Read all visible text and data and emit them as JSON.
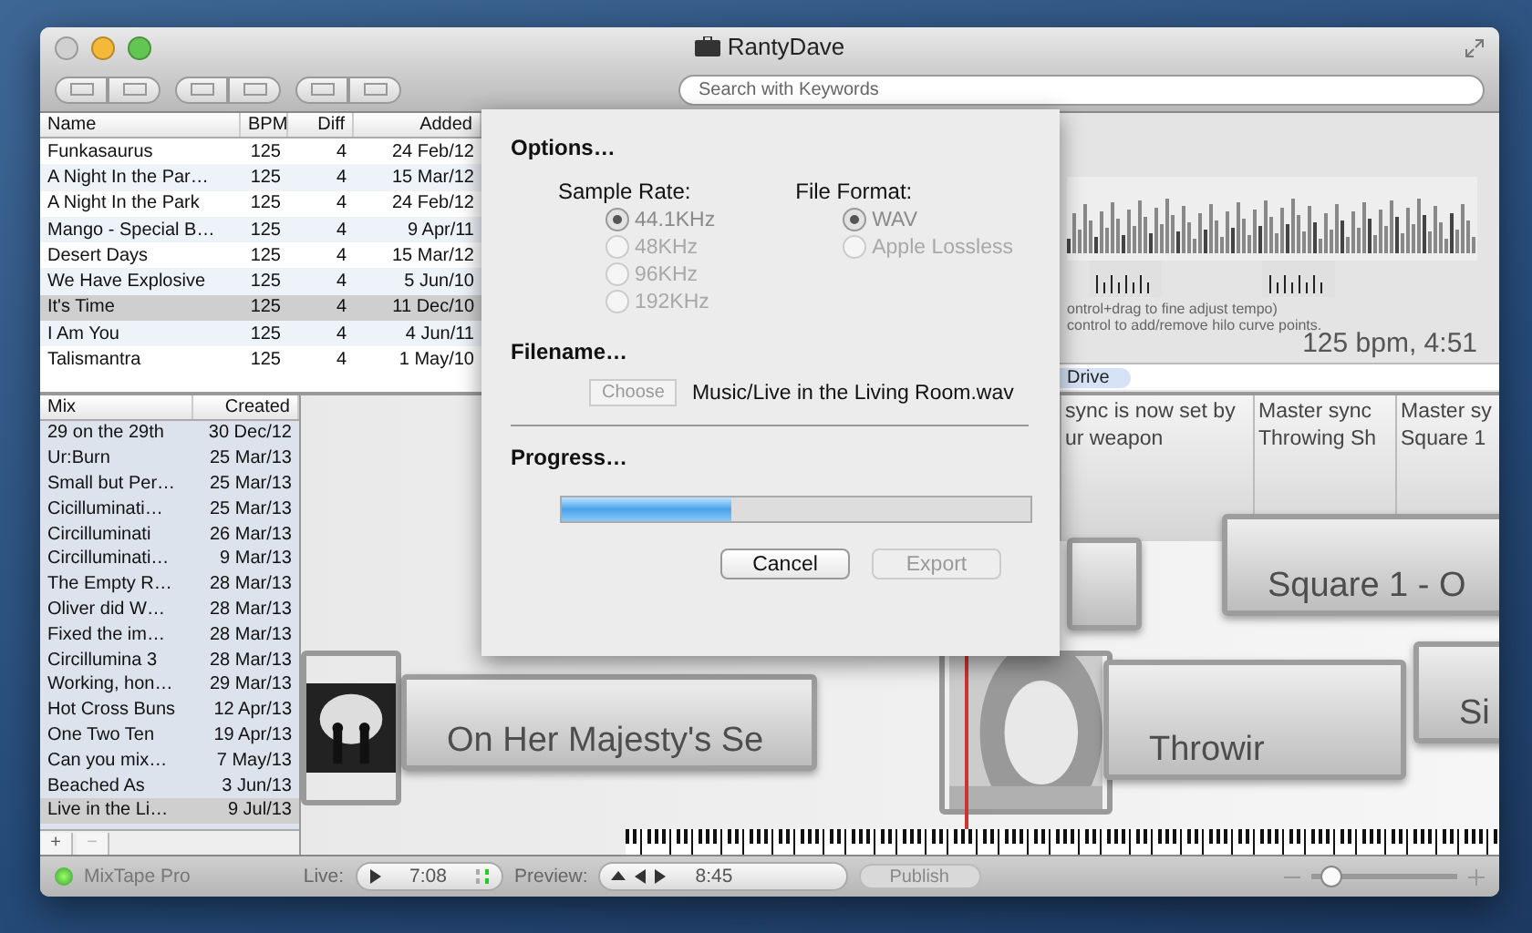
{
  "window": {
    "title": "RantyDave"
  },
  "search": {
    "placeholder": "Search with Keywords"
  },
  "tracks": {
    "columns": [
      "Name",
      "BPM",
      "Diff",
      "Added"
    ],
    "rows": [
      {
        "cells": [
          "Funkasaurus",
          "125",
          "4",
          "24 Feb/12"
        ],
        "selected": false
      },
      {
        "cells": [
          "A Night In the Par…",
          "125",
          "4",
          "15 Mar/12"
        ],
        "selected": false
      },
      {
        "cells": [
          "A Night In the Park",
          "125",
          "4",
          "24 Feb/12"
        ],
        "selected": false
      },
      {
        "cells": [
          "Mango - Special B…",
          "125",
          "4",
          "9 Apr/11"
        ],
        "selected": false
      },
      {
        "cells": [
          "Desert Days",
          "125",
          "4",
          "15 Mar/12"
        ],
        "selected": false
      },
      {
        "cells": [
          "We Have Explosive",
          "125",
          "4",
          "5 Jun/10"
        ],
        "selected": false
      },
      {
        "cells": [
          "It's Time",
          "125",
          "4",
          "11 Dec/10"
        ],
        "selected": true
      },
      {
        "cells": [
          "I Am You",
          "125",
          "4",
          "4 Jun/11"
        ],
        "selected": false
      },
      {
        "cells": [
          "Talismantra",
          "125",
          "4",
          "1 May/10"
        ],
        "selected": false
      }
    ]
  },
  "mixes": {
    "columns": [
      "Mix",
      "Created"
    ],
    "rows": [
      {
        "cells": [
          "29 on the 29th",
          "30 Dec/12"
        ],
        "selected": false
      },
      {
        "cells": [
          "Ur:Burn",
          "25 Mar/13"
        ],
        "selected": false
      },
      {
        "cells": [
          "Small but Per…",
          "25 Mar/13"
        ],
        "selected": false
      },
      {
        "cells": [
          "Cicilluminati…",
          "25 Mar/13"
        ],
        "selected": false
      },
      {
        "cells": [
          "Circilluminati",
          "26 Mar/13"
        ],
        "selected": false
      },
      {
        "cells": [
          "Circilluminati…",
          "9 Mar/13"
        ],
        "selected": false
      },
      {
        "cells": [
          "The Empty R…",
          "28 Mar/13"
        ],
        "selected": false
      },
      {
        "cells": [
          "Oliver did W…",
          "28 Mar/13"
        ],
        "selected": false
      },
      {
        "cells": [
          "Fixed the im…",
          "28 Mar/13"
        ],
        "selected": false
      },
      {
        "cells": [
          "Circillumina 3",
          "28 Mar/13"
        ],
        "selected": false
      },
      {
        "cells": [
          "Working, hon…",
          "29 Mar/13"
        ],
        "selected": false
      },
      {
        "cells": [
          "Hot Cross Buns",
          "12 Apr/13"
        ],
        "selected": false
      },
      {
        "cells": [
          "One Two Ten",
          "19 Apr/13"
        ],
        "selected": false
      },
      {
        "cells": [
          "Can you mix…",
          "7 May/13"
        ],
        "selected": false
      },
      {
        "cells": [
          "Beached As",
          "3 Jun/13"
        ],
        "selected": false
      },
      {
        "cells": [
          "Live in the Li…",
          "9 Jul/13"
        ],
        "selected": true
      }
    ],
    "add": "+",
    "remove": "−"
  },
  "waveform": {
    "hints": [
      "ontrol+drag to fine adjust tempo)",
      "control to add/remove hilo curve points."
    ],
    "reading": "125 bpm, 4:51"
  },
  "tags": [
    {
      "label": "Drive",
      "selected": true
    }
  ],
  "sync_notes": [
    {
      "lines": [
        "sync is now set by",
        "ur weapon"
      ]
    },
    {
      "lines": [
        "Master sync",
        "Throwing Sh"
      ]
    },
    {
      "lines": [
        "Master sy",
        "Square 1"
      ]
    }
  ],
  "clips": [
    {
      "kind": "titled",
      "title": "On Her Majesty's Se"
    },
    {
      "kind": "blank"
    },
    {
      "kind": "titled",
      "title": "Throwir"
    },
    {
      "kind": "titled",
      "title": "Square 1 - O"
    },
    {
      "kind": "titled",
      "title": "Si"
    }
  ],
  "status": {
    "app": "MixTape Pro",
    "live_label": "Live:",
    "live_time": "7:08",
    "preview_label": "Preview:",
    "preview_time": "8:45",
    "publish": "Publish",
    "zoom": {
      "level": 0.12
    }
  },
  "dialog": {
    "options": "Options…",
    "sample_rate_label": "Sample Rate:",
    "format_label": "File Format:",
    "sample_rates": [
      {
        "label": "44.1KHz",
        "selected": true
      },
      {
        "label": "48KHz",
        "selected": false
      },
      {
        "label": "96KHz",
        "selected": false
      },
      {
        "label": "192KHz",
        "selected": false
      }
    ],
    "formats": [
      {
        "label": "WAV",
        "selected": true
      },
      {
        "label": "Apple Lossless",
        "selected": false
      }
    ],
    "options_disabled": true,
    "filename_heading": "Filename…",
    "choose": "Choose",
    "filename": "Music/Live in the Living Room.wav",
    "progress_heading": "Progress…",
    "progress": {
      "level": 0.36
    },
    "buttons": [
      {
        "label": "Cancel",
        "disabled": false
      },
      {
        "label": "Export",
        "disabled": true
      }
    ]
  }
}
